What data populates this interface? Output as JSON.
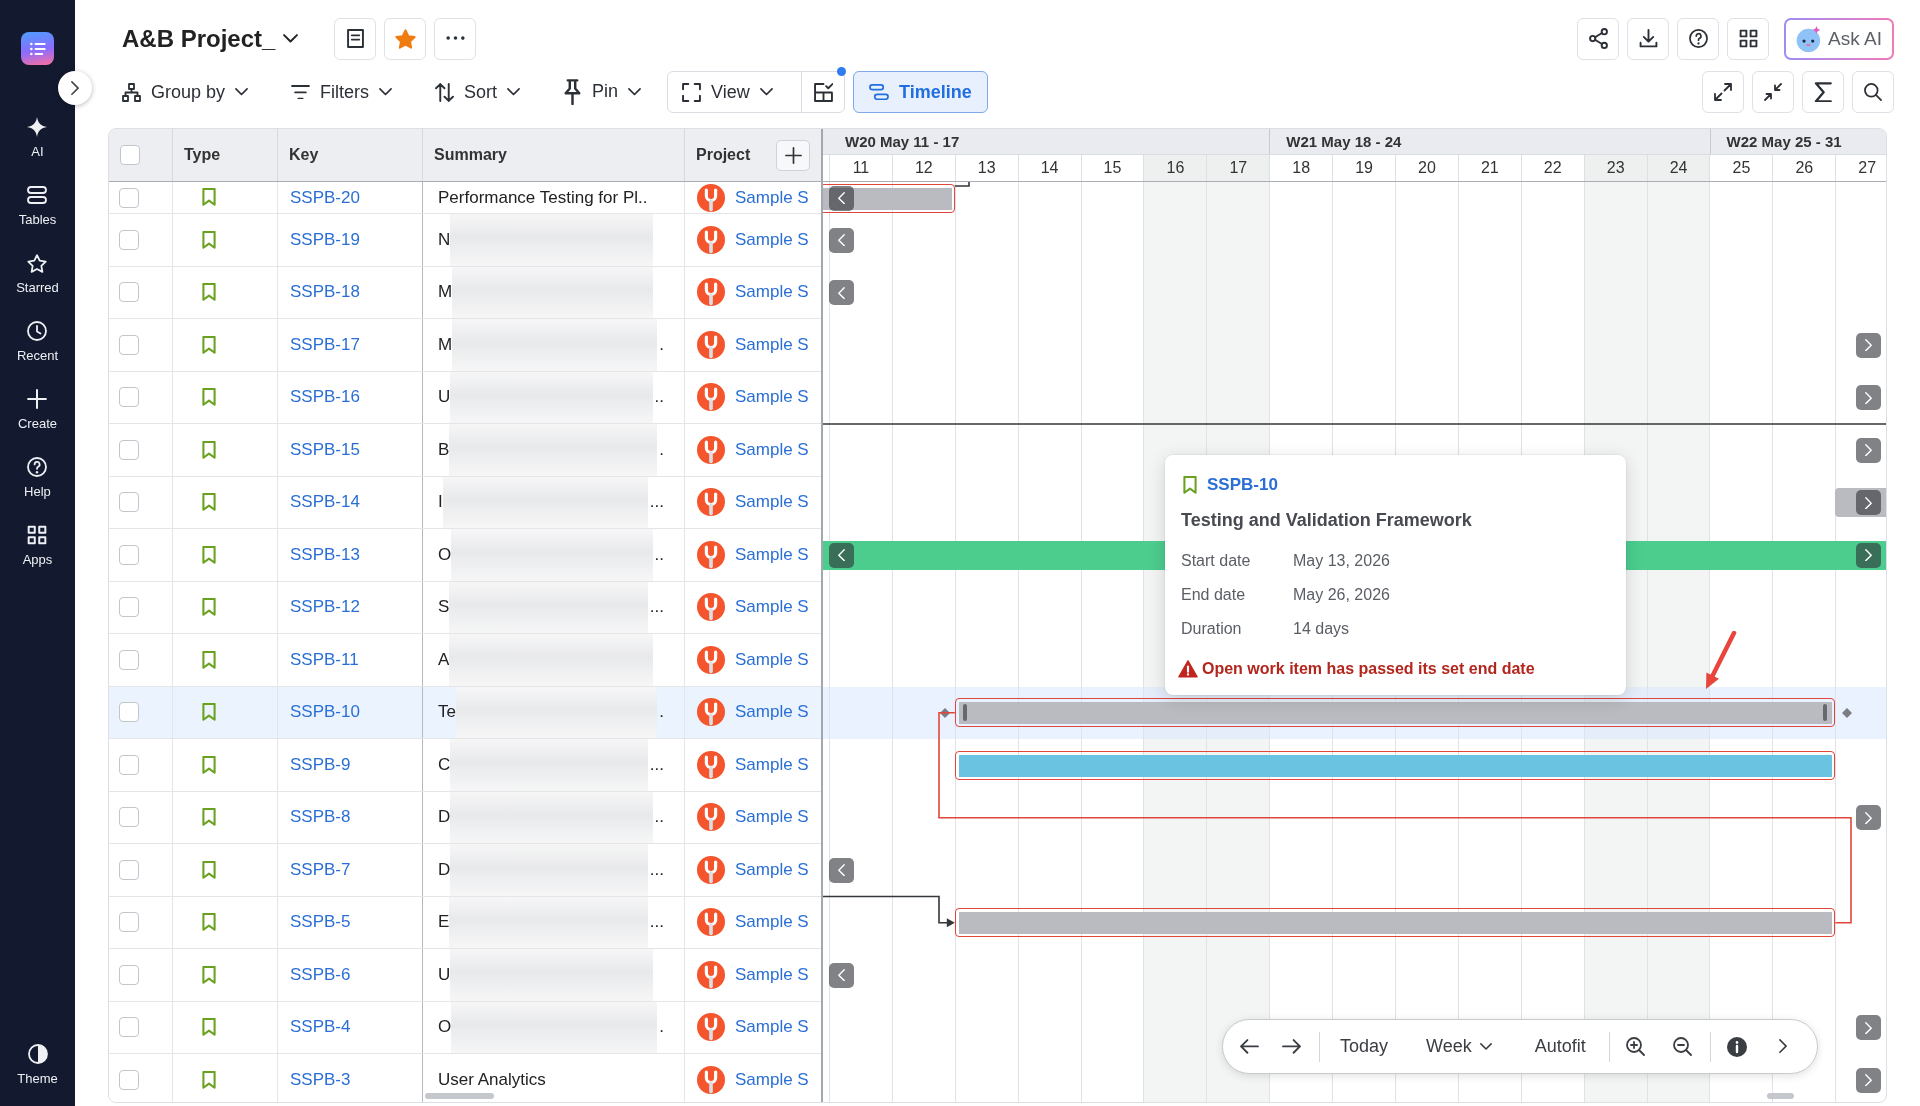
{
  "sidebar": {
    "items": [
      {
        "label": "AI"
      },
      {
        "label": "Tables"
      },
      {
        "label": "Starred"
      },
      {
        "label": "Recent"
      },
      {
        "label": "Create"
      },
      {
        "label": "Help"
      },
      {
        "label": "Apps"
      }
    ],
    "footer": {
      "label": "Theme"
    }
  },
  "header": {
    "title": "A&B Project_",
    "starred": true,
    "ask_ai": "Ask AI"
  },
  "toolbar": {
    "dropdowns": [
      {
        "label": "Group by"
      },
      {
        "label": "Filters"
      },
      {
        "label": "Sort"
      },
      {
        "label": "Pin"
      }
    ],
    "view": {
      "label": "View",
      "layout_badge": true
    },
    "timeline_button": {
      "label": "Timeline",
      "selected": true
    }
  },
  "table": {
    "all_checked": false,
    "columns": [
      "Type",
      "Key",
      "Summary",
      "Project"
    ],
    "rows": [
      {
        "key": "SSPB-20",
        "summary": "Performance Testing for Pl..",
        "redacted": false,
        "project": "Sample S",
        "checked": false,
        "selected": false,
        "timeline": {
          "kind": "bar",
          "extends_left": true,
          "extends_right": false,
          "color": "#b9bbc1",
          "flagged": true
        }
      },
      {
        "key": "SSPB-19",
        "summary": "N",
        "redacted": true,
        "project": "Sample S",
        "checked": false,
        "selected": false,
        "timeline": {
          "kind": "earlier"
        }
      },
      {
        "key": "SSPB-18",
        "summary": "M",
        "redacted": true,
        "project": "Sample S",
        "checked": false,
        "selected": false,
        "timeline": {
          "kind": "earlier"
        }
      },
      {
        "key": "SSPB-17",
        "summary": "M",
        "summary_tail": ".",
        "redacted": true,
        "project": "Sample S",
        "checked": false,
        "selected": false,
        "timeline": {
          "kind": "later"
        }
      },
      {
        "key": "SSPB-16",
        "summary": "U",
        "summary_tail": "..",
        "redacted": true,
        "project": "Sample S",
        "checked": false,
        "selected": false,
        "timeline": {
          "kind": "later"
        }
      },
      {
        "key": "SSPB-15",
        "summary": "B",
        "summary_tail": ".",
        "redacted": true,
        "project": "Sample S",
        "checked": false,
        "selected": false,
        "timeline": {
          "kind": "later"
        }
      },
      {
        "key": "SSPB-14",
        "summary": "I",
        "summary_tail": "...",
        "redacted": true,
        "project": "Sample S",
        "checked": false,
        "selected": false,
        "timeline": {
          "kind": "bar",
          "extends_left": false,
          "extends_right": true,
          "color": "#b9bbc1",
          "flagged": false
        }
      },
      {
        "key": "SSPB-13",
        "summary": "O",
        "summary_tail": "..",
        "redacted": true,
        "project": "Sample S",
        "checked": false,
        "selected": false,
        "timeline": {
          "kind": "bar",
          "extends_left": true,
          "extends_right": true,
          "color": "#4ccd8e",
          "flagged": false
        }
      },
      {
        "key": "SSPB-12",
        "summary": "S",
        "summary_tail": "...",
        "redacted": true,
        "project": "Sample S",
        "checked": false,
        "selected": false
      },
      {
        "key": "SSPB-11",
        "summary": "A",
        "redacted": true,
        "project": "Sample S",
        "checked": false,
        "selected": false
      },
      {
        "key": "SSPB-10",
        "summary": "Te",
        "summary_tail": ".",
        "redacted": true,
        "project": "Sample S",
        "checked": false,
        "selected": true,
        "timeline": {
          "kind": "bar",
          "extends_left": false,
          "extends_right": false,
          "color": "#b9bbc1",
          "flagged": true
        }
      },
      {
        "key": "SSPB-9",
        "summary": "C",
        "summary_tail": "...",
        "redacted": true,
        "project": "Sample S",
        "checked": false,
        "selected": false,
        "timeline": {
          "kind": "bar",
          "extends_left": false,
          "extends_right": false,
          "color": "#6ac4e1",
          "flagged": true
        }
      },
      {
        "key": "SSPB-8",
        "summary": "D",
        "summary_tail": "..",
        "redacted": true,
        "project": "Sample S",
        "checked": false,
        "selected": false,
        "timeline": {
          "kind": "later"
        }
      },
      {
        "key": "SSPB-7",
        "summary": "D",
        "summary_tail": "...",
        "redacted": true,
        "project": "Sample S",
        "checked": false,
        "selected": false,
        "timeline": {
          "kind": "earlier"
        }
      },
      {
        "key": "SSPB-5",
        "summary": "E",
        "summary_tail": "...",
        "redacted": true,
        "project": "Sample S",
        "checked": false,
        "selected": false,
        "timeline": {
          "kind": "bar",
          "extends_left": false,
          "extends_right": false,
          "color": "#b9bbc1",
          "flagged": true
        }
      },
      {
        "key": "SSPB-6",
        "summary": "U",
        "redacted": true,
        "project": "Sample S",
        "checked": false,
        "selected": false,
        "timeline": {
          "kind": "earlier"
        }
      },
      {
        "key": "SSPB-4",
        "summary": "O",
        "summary_tail": ".",
        "redacted": true,
        "project": "Sample S",
        "checked": false,
        "selected": false,
        "timeline": {
          "kind": "later"
        }
      },
      {
        "key": "SSPB-3",
        "summary": "User Analytics",
        "redacted": false,
        "project": "Sample S",
        "checked": false,
        "selected": false,
        "timeline": {
          "kind": "later"
        }
      }
    ]
  },
  "timeline": {
    "weeks": [
      {
        "label": "W20 May 11 - 17"
      },
      {
        "label": "W21 May 18 - 24"
      },
      {
        "label": "W22 May 25 - 31"
      }
    ],
    "days": [
      {
        "label": "11",
        "weekend": false
      },
      {
        "label": "12",
        "weekend": false
      },
      {
        "label": "13",
        "weekend": false
      },
      {
        "label": "14",
        "weekend": false
      },
      {
        "label": "15",
        "weekend": false
      },
      {
        "label": "16",
        "weekend": true
      },
      {
        "label": "17",
        "weekend": true
      },
      {
        "label": "18",
        "weekend": false
      },
      {
        "label": "19",
        "weekend": false
      },
      {
        "label": "20",
        "weekend": false
      },
      {
        "label": "21",
        "weekend": false
      },
      {
        "label": "22",
        "weekend": false
      },
      {
        "label": "23",
        "weekend": true
      },
      {
        "label": "24",
        "weekend": true
      },
      {
        "label": "25",
        "weekend": false
      },
      {
        "label": "26",
        "weekend": false
      },
      {
        "label": "27",
        "weekend": false
      }
    ],
    "tooltip": {
      "key": "SSPB-10",
      "title": "Testing and Validation Framework",
      "fields": [
        {
          "label": "Start date",
          "value": "May 13, 2026"
        },
        {
          "label": "End date",
          "value": "May 26, 2026"
        },
        {
          "label": "Duration",
          "value": "14 days"
        }
      ],
      "warning": "Open work item has passed its set end date"
    },
    "nav": {
      "today": "Today",
      "scale": "Week",
      "autofit": "Autofit"
    }
  }
}
